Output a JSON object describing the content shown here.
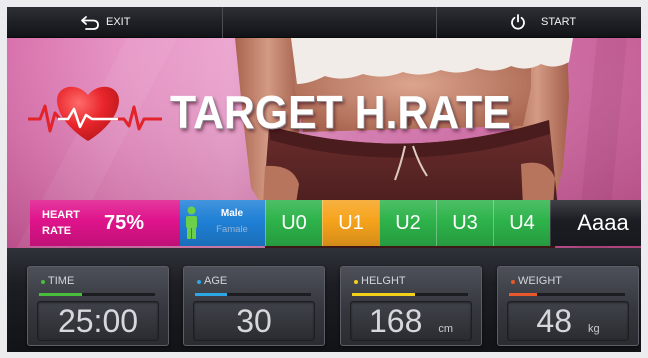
{
  "top_bar": {
    "exit_label": "EXIT",
    "exit_icon": "return-arrow-icon",
    "start_label": "START",
    "start_icon": "power-icon"
  },
  "hero": {
    "title": "TARGET H.RATE",
    "icon": "heart-ecg-icon"
  },
  "mode_bar": {
    "heart_rate": {
      "label_line1": "HEART",
      "label_line2": "RATE",
      "value": "75%"
    },
    "gender": {
      "male_label": "Male",
      "female_label": "Famale",
      "male_selected": true,
      "icon": "person-icon"
    },
    "levels": [
      {
        "label": "U0",
        "active": false
      },
      {
        "label": "U1",
        "active": true
      },
      {
        "label": "U2",
        "active": false
      },
      {
        "label": "U3",
        "active": false
      },
      {
        "label": "U4",
        "active": false
      }
    ],
    "user_name": "Aaaa"
  },
  "stats": [
    {
      "label": "TIME",
      "value": "25:00",
      "progress": 0.37,
      "color": "#48bf3a"
    },
    {
      "label": "AGE",
      "value": "30",
      "progress": 0.28,
      "color": "#2aa7e4"
    },
    {
      "label": "HELGHT",
      "value": "168",
      "unit": "cm",
      "progress": 0.54,
      "color": "#f2d11c"
    },
    {
      "label": "WEIGHT",
      "value": "48",
      "unit": "kg",
      "progress": 0.24,
      "color": "#e8582a"
    }
  ],
  "colors": {
    "heart_rate": "#df138b",
    "gender": "#1f80d6",
    "gender_icon": "#6ccf4a",
    "level": "#2db34a",
    "level_active": "#f6a31c",
    "user": "#1b1d23",
    "selected_text": "#ffffff",
    "unselected_text": "#93b3d6"
  }
}
